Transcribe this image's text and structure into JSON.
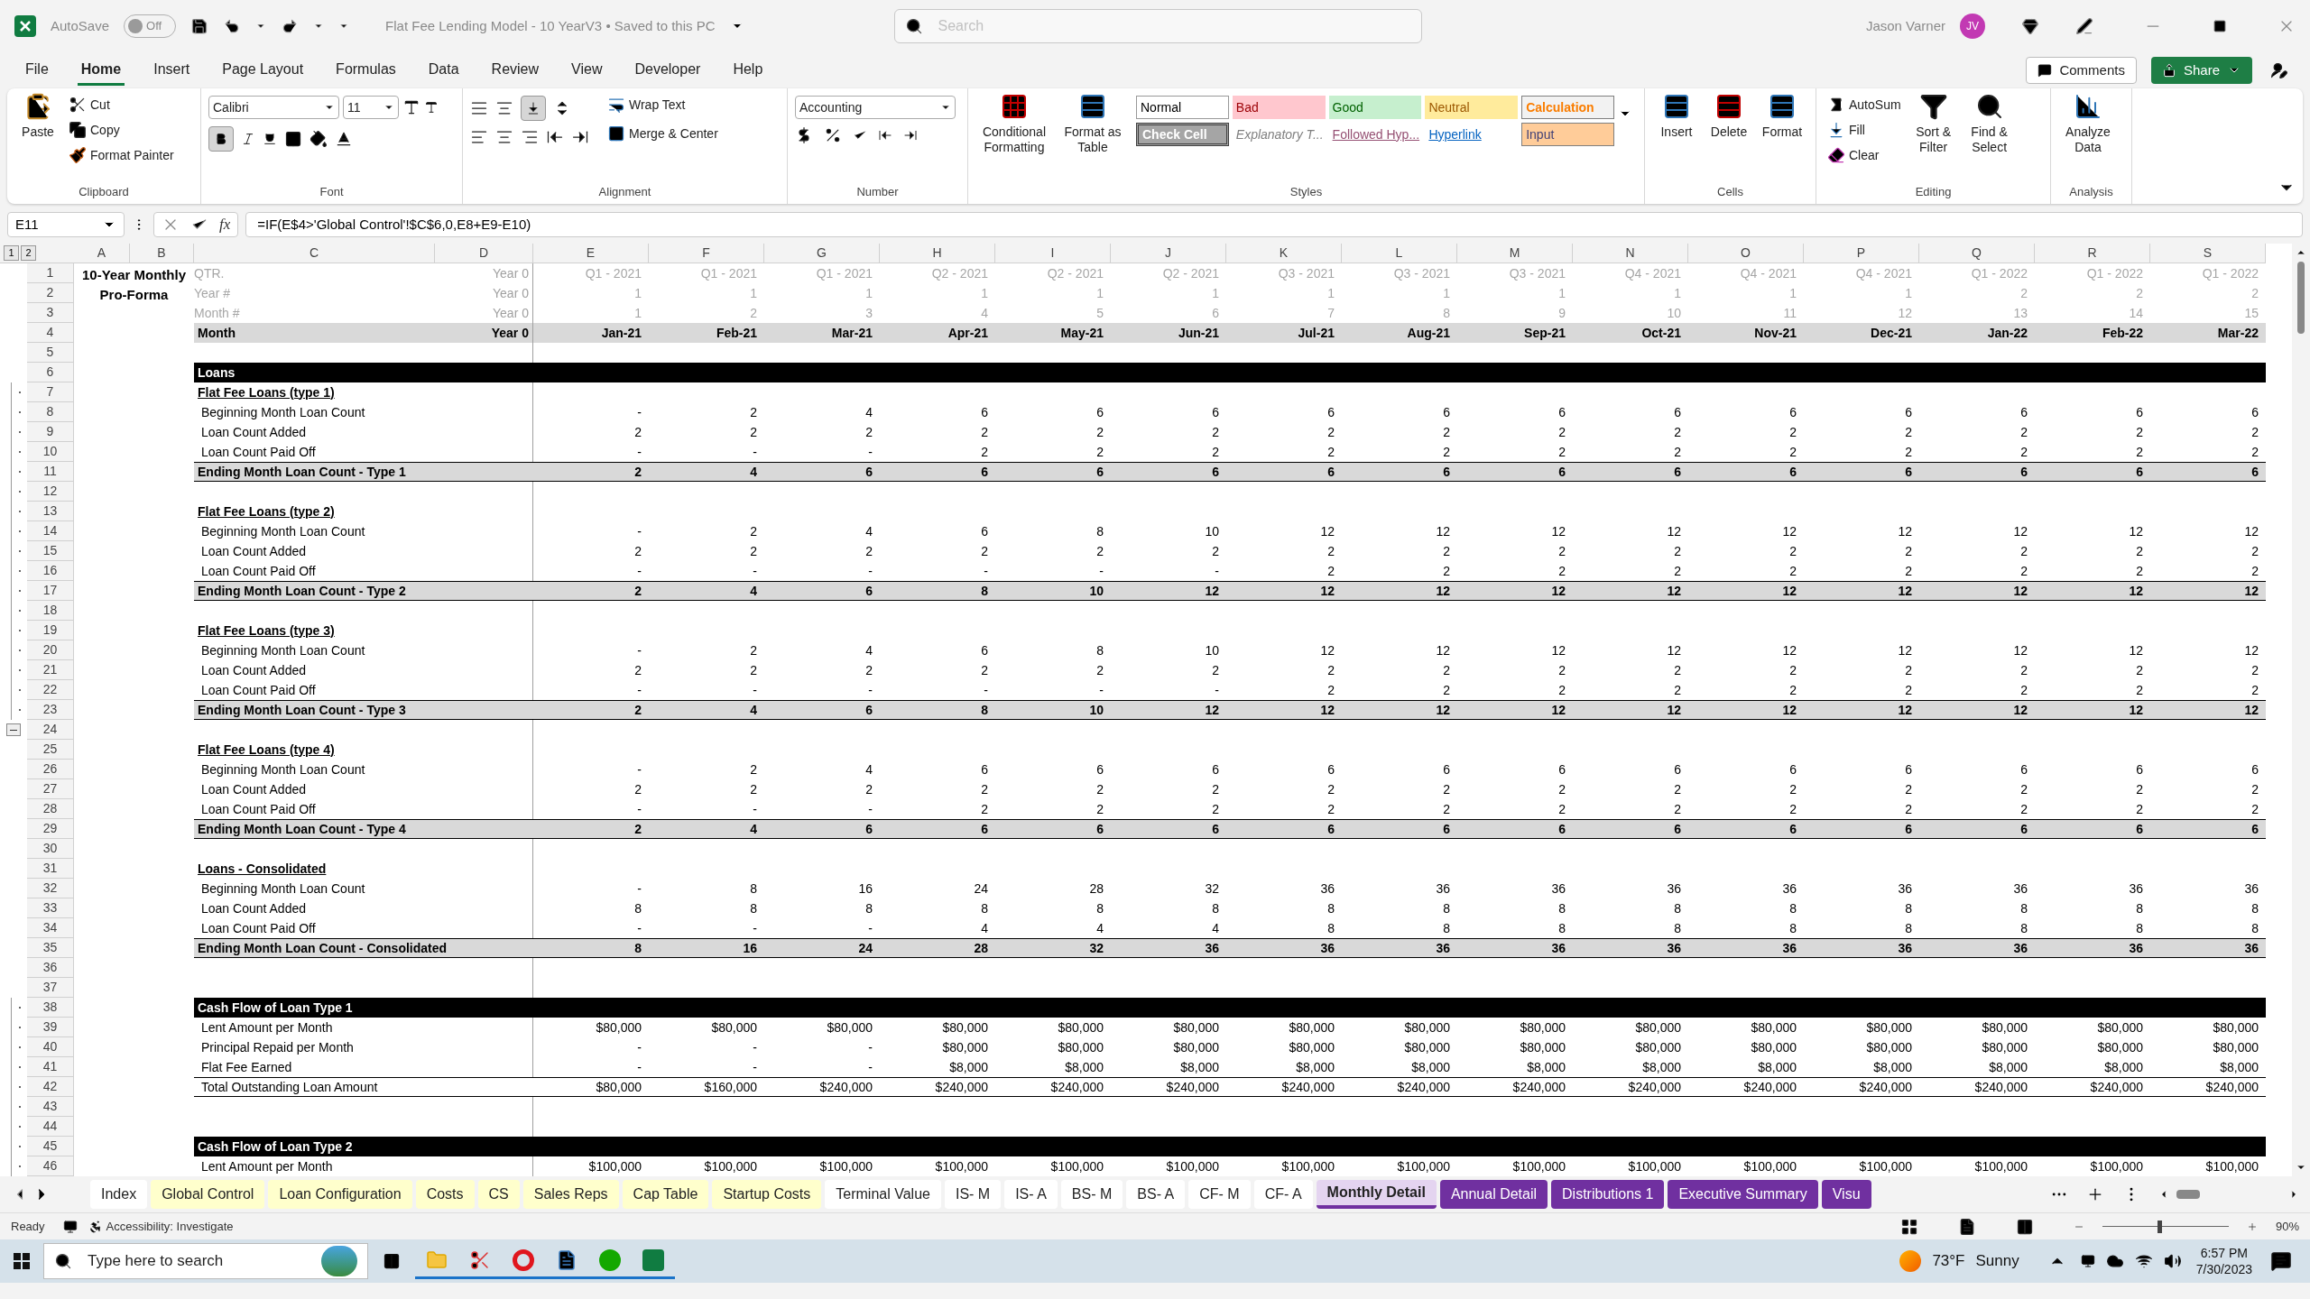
{
  "title_bar": {
    "autosave_label": "AutoSave",
    "autosave_on": false,
    "autosave_state": "Off",
    "document_title": "Flat Fee Lending Model - 10 YearV3 • Saved to this PC",
    "search_placeholder": "Search",
    "user_name": "Jason Varner",
    "user_initials": "JV"
  },
  "menu_tabs": [
    {
      "label": "File",
      "selected": false
    },
    {
      "label": "Home",
      "selected": true
    },
    {
      "label": "Insert",
      "selected": false
    },
    {
      "label": "Page Layout",
      "selected": false
    },
    {
      "label": "Formulas",
      "selected": false
    },
    {
      "label": "Data",
      "selected": false
    },
    {
      "label": "Review",
      "selected": false
    },
    {
      "label": "View",
      "selected": false
    },
    {
      "label": "Developer",
      "selected": false
    },
    {
      "label": "Help",
      "selected": false
    }
  ],
  "comments_button": "Comments",
  "share_button": "Share",
  "ribbon": {
    "clipboard": {
      "label": "Clipboard",
      "paste": "Paste",
      "cut": "Cut",
      "copy": "Copy",
      "format_painter": "Format Painter"
    },
    "font": {
      "label": "Font",
      "font_name": "Calibri",
      "font_size": "11",
      "bold_pressed": true
    },
    "alignment": {
      "label": "Alignment",
      "wrap_text": "Wrap Text",
      "merge_center": "Merge & Center",
      "bottom_align_pressed": true
    },
    "number": {
      "label": "Number",
      "format": "Accounting"
    },
    "styles": {
      "label": "Styles",
      "conditional_formatting": "Conditional Formatting",
      "format_as_table": "Format as Table",
      "gallery": [
        {
          "kind": "normal",
          "label": "Normal"
        },
        {
          "kind": "bad",
          "label": "Bad"
        },
        {
          "kind": "good",
          "label": "Good"
        },
        {
          "kind": "neutral",
          "label": "Neutral"
        },
        {
          "kind": "calculation",
          "label": "Calculation"
        },
        {
          "kind": "check",
          "label": "Check Cell"
        },
        {
          "kind": "explanatory",
          "label": "Explanatory T..."
        },
        {
          "kind": "followed",
          "label": "Followed Hyp..."
        },
        {
          "kind": "hyperlink",
          "label": "Hyperlink"
        },
        {
          "kind": "input",
          "label": "Input"
        }
      ]
    },
    "cells": {
      "label": "Cells",
      "insert": "Insert",
      "delete": "Delete",
      "format": "Format"
    },
    "editing": {
      "label": "Editing",
      "autosum": "AutoSum",
      "fill": "Fill",
      "clear": "Clear",
      "sort_filter": "Sort & Filter",
      "find_select": "Find & Select"
    },
    "analysis": {
      "label": "Analysis",
      "analyze_data": "Analyze Data"
    }
  },
  "formula_bar": {
    "name_box": "E11",
    "function_button": "fx",
    "formula": "=IF(E$4>'Global Control'!$C$6,0,E8+E9-E10)"
  },
  "sheet": {
    "outline_levels": [
      "1",
      "2"
    ],
    "columns": [
      "A",
      "B",
      "C",
      "D",
      "E",
      "F",
      "G",
      "H",
      "I",
      "J",
      "K",
      "L",
      "M",
      "N",
      "O",
      "P",
      "Q",
      "R",
      "S"
    ],
    "title": "10-Year Monthly Pro-Forma",
    "rows": [
      {
        "n": "1",
        "kind": "meta",
        "label": "QTR.",
        "column_d": "Year 0",
        "values": [
          "Q1 - 2021",
          "Q1 - 2021",
          "Q1 - 2021",
          "Q2 - 2021",
          "Q2 - 2021",
          "Q2 - 2021",
          "Q3 - 2021",
          "Q3 - 2021",
          "Q3 - 2021",
          "Q4 - 2021",
          "Q4 - 2021",
          "Q4 - 2021",
          "Q1 - 2022",
          "Q1 - 2022",
          "Q1 - 2022"
        ]
      },
      {
        "n": "2",
        "kind": "meta",
        "label": "Year #",
        "column_d": "Year 0",
        "values": [
          "1",
          "1",
          "1",
          "1",
          "1",
          "1",
          "1",
          "1",
          "1",
          "1",
          "1",
          "1",
          "2",
          "2",
          "2"
        ]
      },
      {
        "n": "3",
        "kind": "meta",
        "label": "Month #",
        "column_d": "Year 0",
        "values": [
          "1",
          "2",
          "3",
          "4",
          "5",
          "6",
          "7",
          "8",
          "9",
          "10",
          "11",
          "12",
          "13",
          "14",
          "15"
        ]
      },
      {
        "n": "4",
        "kind": "month",
        "label": "Month",
        "column_d": "Year 0",
        "values": [
          "Jan-21",
          "Feb-21",
          "Mar-21",
          "Apr-21",
          "May-21",
          "Jun-21",
          "Jul-21",
          "Aug-21",
          "Sep-21",
          "Oct-21",
          "Nov-21",
          "Dec-21",
          "Jan-22",
          "Feb-22",
          "Mar-22"
        ]
      },
      {
        "n": "5",
        "kind": "blank"
      },
      {
        "n": "6",
        "kind": "section",
        "label": "Loans"
      },
      {
        "n": "7",
        "kind": "subheading",
        "grouped": true,
        "label": "Flat Fee Loans (type 1)"
      },
      {
        "n": "8",
        "kind": "item",
        "grouped": true,
        "label": "Beginning Month Loan Count",
        "values": [
          "-",
          "2",
          "4",
          "6",
          "6",
          "6",
          "6",
          "6",
          "6",
          "6",
          "6",
          "6",
          "6",
          "6",
          "6"
        ]
      },
      {
        "n": "9",
        "kind": "item",
        "grouped": true,
        "label": "Loan Count Added",
        "values": [
          "2",
          "2",
          "2",
          "2",
          "2",
          "2",
          "2",
          "2",
          "2",
          "2",
          "2",
          "2",
          "2",
          "2",
          "2"
        ]
      },
      {
        "n": "10",
        "kind": "item",
        "grouped": true,
        "label": "Loan Count Paid Off",
        "values": [
          "-",
          "-",
          "-",
          "2",
          "2",
          "2",
          "2",
          "2",
          "2",
          "2",
          "2",
          "2",
          "2",
          "2",
          "2"
        ]
      },
      {
        "n": "11",
        "kind": "total",
        "grouped": true,
        "label": "Ending Month Loan Count - Type 1",
        "values": [
          "2",
          "4",
          "6",
          "6",
          "6",
          "6",
          "6",
          "6",
          "6",
          "6",
          "6",
          "6",
          "6",
          "6",
          "6"
        ]
      },
      {
        "n": "12",
        "kind": "blank",
        "grouped": true
      },
      {
        "n": "13",
        "kind": "subheading",
        "grouped": true,
        "label": "Flat Fee Loans (type 2)"
      },
      {
        "n": "14",
        "kind": "item",
        "grouped": true,
        "label": "Beginning Month Loan Count",
        "values": [
          "-",
          "2",
          "4",
          "6",
          "8",
          "10",
          "12",
          "12",
          "12",
          "12",
          "12",
          "12",
          "12",
          "12",
          "12"
        ]
      },
      {
        "n": "15",
        "kind": "item",
        "grouped": true,
        "label": "Loan Count Added",
        "values": [
          "2",
          "2",
          "2",
          "2",
          "2",
          "2",
          "2",
          "2",
          "2",
          "2",
          "2",
          "2",
          "2",
          "2",
          "2"
        ]
      },
      {
        "n": "16",
        "kind": "item",
        "grouped": true,
        "label": "Loan Count Paid Off",
        "values": [
          "-",
          "-",
          "-",
          "-",
          "-",
          "-",
          "2",
          "2",
          "2",
          "2",
          "2",
          "2",
          "2",
          "2",
          "2"
        ]
      },
      {
        "n": "17",
        "kind": "total",
        "grouped": true,
        "label": "Ending Month Loan Count - Type 2",
        "values": [
          "2",
          "4",
          "6",
          "8",
          "10",
          "12",
          "12",
          "12",
          "12",
          "12",
          "12",
          "12",
          "12",
          "12",
          "12"
        ]
      },
      {
        "n": "18",
        "kind": "blank",
        "grouped": true
      },
      {
        "n": "19",
        "kind": "subheading",
        "grouped": true,
        "label": "Flat Fee Loans (type 3)"
      },
      {
        "n": "20",
        "kind": "item",
        "grouped": true,
        "label": "Beginning Month Loan Count",
        "values": [
          "-",
          "2",
          "4",
          "6",
          "8",
          "10",
          "12",
          "12",
          "12",
          "12",
          "12",
          "12",
          "12",
          "12",
          "12"
        ]
      },
      {
        "n": "21",
        "kind": "item",
        "grouped": true,
        "label": "Loan Count Added",
        "values": [
          "2",
          "2",
          "2",
          "2",
          "2",
          "2",
          "2",
          "2",
          "2",
          "2",
          "2",
          "2",
          "2",
          "2",
          "2"
        ]
      },
      {
        "n": "22",
        "kind": "item",
        "grouped": true,
        "label": "Loan Count Paid Off",
        "values": [
          "-",
          "-",
          "-",
          "-",
          "-",
          "-",
          "2",
          "2",
          "2",
          "2",
          "2",
          "2",
          "2",
          "2",
          "2"
        ]
      },
      {
        "n": "23",
        "kind": "total",
        "grouped": true,
        "label": "Ending Month Loan Count - Type 3",
        "values": [
          "2",
          "4",
          "6",
          "8",
          "10",
          "12",
          "12",
          "12",
          "12",
          "12",
          "12",
          "12",
          "12",
          "12",
          "12"
        ]
      },
      {
        "n": "24",
        "kind": "blank",
        "collapse_button": true
      },
      {
        "n": "25",
        "kind": "subheading",
        "label": "Flat Fee Loans (type 4)"
      },
      {
        "n": "26",
        "kind": "item",
        "label": "Beginning Month Loan Count",
        "values": [
          "-",
          "2",
          "4",
          "6",
          "6",
          "6",
          "6",
          "6",
          "6",
          "6",
          "6",
          "6",
          "6",
          "6",
          "6"
        ]
      },
      {
        "n": "27",
        "kind": "item",
        "label": "Loan Count Added",
        "values": [
          "2",
          "2",
          "2",
          "2",
          "2",
          "2",
          "2",
          "2",
          "2",
          "2",
          "2",
          "2",
          "2",
          "2",
          "2"
        ]
      },
      {
        "n": "28",
        "kind": "item",
        "label": "Loan Count Paid Off",
        "values": [
          "-",
          "-",
          "-",
          "2",
          "2",
          "2",
          "2",
          "2",
          "2",
          "2",
          "2",
          "2",
          "2",
          "2",
          "2"
        ]
      },
      {
        "n": "29",
        "kind": "total",
        "label": "Ending Month Loan Count - Type 4",
        "values": [
          "2",
          "4",
          "6",
          "6",
          "6",
          "6",
          "6",
          "6",
          "6",
          "6",
          "6",
          "6",
          "6",
          "6",
          "6"
        ]
      },
      {
        "n": "30",
        "kind": "blank"
      },
      {
        "n": "31",
        "kind": "subheading",
        "label": "Loans - Consolidated"
      },
      {
        "n": "32",
        "kind": "item",
        "label": "Beginning Month Loan Count",
        "values": [
          "-",
          "8",
          "16",
          "24",
          "28",
          "32",
          "36",
          "36",
          "36",
          "36",
          "36",
          "36",
          "36",
          "36",
          "36"
        ]
      },
      {
        "n": "33",
        "kind": "item",
        "label": "Loan Count Added",
        "values": [
          "8",
          "8",
          "8",
          "8",
          "8",
          "8",
          "8",
          "8",
          "8",
          "8",
          "8",
          "8",
          "8",
          "8",
          "8"
        ]
      },
      {
        "n": "34",
        "kind": "item",
        "label": "Loan Count Paid Off",
        "values": [
          "-",
          "-",
          "-",
          "4",
          "4",
          "4",
          "8",
          "8",
          "8",
          "8",
          "8",
          "8",
          "8",
          "8",
          "8"
        ]
      },
      {
        "n": "35",
        "kind": "total",
        "label": "Ending Month Loan Count - Consolidated",
        "values": [
          "8",
          "16",
          "24",
          "28",
          "32",
          "36",
          "36",
          "36",
          "36",
          "36",
          "36",
          "36",
          "36",
          "36",
          "36"
        ]
      },
      {
        "n": "36",
        "kind": "blank"
      },
      {
        "n": "37",
        "kind": "blank"
      },
      {
        "n": "38",
        "kind": "section",
        "grouped": true,
        "label": "Cash Flow of Loan Type 1"
      },
      {
        "n": "39",
        "kind": "item",
        "grouped": true,
        "label": "Lent Amount per Month",
        "values": [
          "$80,000",
          "$80,000",
          "$80,000",
          "$80,000",
          "$80,000",
          "$80,000",
          "$80,000",
          "$80,000",
          "$80,000",
          "$80,000",
          "$80,000",
          "$80,000",
          "$80,000",
          "$80,000",
          "$80,000"
        ]
      },
      {
        "n": "40",
        "kind": "item",
        "grouped": true,
        "label": "Principal Repaid per Month",
        "values": [
          "-",
          "-",
          "-",
          "$80,000",
          "$80,000",
          "$80,000",
          "$80,000",
          "$80,000",
          "$80,000",
          "$80,000",
          "$80,000",
          "$80,000",
          "$80,000",
          "$80,000",
          "$80,000"
        ]
      },
      {
        "n": "41",
        "kind": "item",
        "grouped": true,
        "label": "Flat Fee Earned",
        "values": [
          "-",
          "-",
          "-",
          "$8,000",
          "$8,000",
          "$8,000",
          "$8,000",
          "$8,000",
          "$8,000",
          "$8,000",
          "$8,000",
          "$8,000",
          "$8,000",
          "$8,000",
          "$8,000"
        ]
      },
      {
        "n": "42",
        "kind": "subtotal",
        "grouped": true,
        "label": "Total Outstanding Loan Amount",
        "values": [
          "$80,000",
          "$160,000",
          "$240,000",
          "$240,000",
          "$240,000",
          "$240,000",
          "$240,000",
          "$240,000",
          "$240,000",
          "$240,000",
          "$240,000",
          "$240,000",
          "$240,000",
          "$240,000",
          "$240,000"
        ]
      },
      {
        "n": "43",
        "kind": "blank",
        "grouped": true
      },
      {
        "n": "44",
        "kind": "blank",
        "grouped": true
      },
      {
        "n": "45",
        "kind": "section",
        "grouped": true,
        "label": "Cash Flow of Loan Type 2"
      },
      {
        "n": "46",
        "kind": "item",
        "grouped": true,
        "label": "Lent Amount per Month",
        "values": [
          "$100,000",
          "$100,000",
          "$100,000",
          "$100,000",
          "$100,000",
          "$100,000",
          "$100,000",
          "$100,000",
          "$100,000",
          "$100,000",
          "$100,000",
          "$100,000",
          "$100,000",
          "$100,000",
          "$100,000"
        ]
      }
    ]
  },
  "sheet_tabs": [
    {
      "label": "Index",
      "selected": false
    },
    {
      "label": "Global Control",
      "selected": false,
      "color": "#ffffcc"
    },
    {
      "label": "Loan Configuration",
      "selected": false,
      "color": "#ffffcc"
    },
    {
      "label": "Costs",
      "selected": false,
      "color": "#ffffcc"
    },
    {
      "label": "CS",
      "selected": false,
      "color": "#ffffcc"
    },
    {
      "label": "Sales Reps",
      "selected": false,
      "color": "#ffffcc"
    },
    {
      "label": "Cap Table",
      "selected": false,
      "color": "#ffffcc"
    },
    {
      "label": "Startup Costs",
      "selected": false,
      "color": "#ffffcc"
    },
    {
      "label": "Terminal Value",
      "selected": false
    },
    {
      "label": "IS- M",
      "selected": false
    },
    {
      "label": "IS- A",
      "selected": false
    },
    {
      "label": "BS- M",
      "selected": false
    },
    {
      "label": "BS- A",
      "selected": false
    },
    {
      "label": "CF- M",
      "selected": false
    },
    {
      "label": "CF- A",
      "selected": false
    },
    {
      "label": "Monthly Detail",
      "selected": true,
      "color": "#7030a0"
    },
    {
      "label": "Annual Detail",
      "selected": false,
      "color": "#7030a0"
    },
    {
      "label": "Distributions 1",
      "selected": false,
      "color": "#7030a0"
    },
    {
      "label": "Executive Summary",
      "selected": false,
      "color": "#7030a0"
    },
    {
      "label": "Visu",
      "selected": false,
      "color": "#7030a0"
    }
  ],
  "status_bar": {
    "ready": "Ready",
    "accessibility": "Accessibility: Investigate",
    "zoom": "90%",
    "zoom_slider": {
      "level": 0.45
    }
  },
  "taskbar": {
    "search_placeholder": "Type here to search",
    "temperature": "73°F",
    "weather": "Sunny",
    "time": "6:57 PM",
    "date": "7/30/2023"
  }
}
